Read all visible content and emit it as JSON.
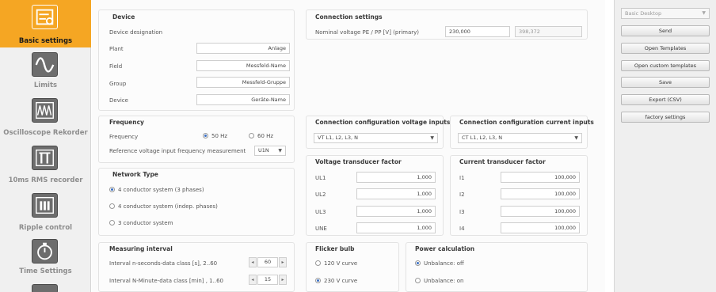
{
  "sidebar": {
    "items": [
      {
        "label": "Basic settings",
        "icon": "settings-sliders-icon",
        "active": true
      },
      {
        "label": "Limits",
        "icon": "sine-wave-icon",
        "active": false
      },
      {
        "label": "Oscilloscope Rekorder",
        "icon": "oscilloscope-icon",
        "active": false
      },
      {
        "label": "10ms RMS recorder",
        "icon": "rms-recorder-icon",
        "active": false
      },
      {
        "label": "Ripple control",
        "icon": "ripple-control-icon",
        "active": false
      },
      {
        "label": "Time Settings",
        "icon": "stopwatch-icon",
        "active": false
      }
    ]
  },
  "device": {
    "title": "Device",
    "designation_label": "Device designation",
    "plant_label": "Plant",
    "plant_value": "Anlage",
    "field_label": "Field",
    "field_value": "Messfeld-Name",
    "group_label": "Group",
    "group_value": "Messfeld-Gruppe",
    "device_label": "Device",
    "device_value": "Geräte-Name"
  },
  "connection": {
    "title": "Connection settings",
    "nominal_label": "Nominal voltage PE / PP [V] (primary)",
    "nominal_value": "230,000",
    "nominal_secondary": "398,372"
  },
  "frequency": {
    "title": "Frequency",
    "label": "Frequency",
    "opt_50": "50 Hz",
    "opt_60": "60 Hz",
    "ref_label": "Reference voltage input frequency measurement",
    "ref_value": "U1N"
  },
  "network": {
    "title": "Network Type",
    "opt1": "4 conductor system (3 phases)",
    "opt2": "4 conductor system (indep. phases)",
    "opt3": "3 conductor system"
  },
  "measuring": {
    "title": "Measuring interval",
    "n_sec_label": "Interval n-seconds-data class [s], 2..60",
    "n_sec_value": "60",
    "n_min_label": "Interval  N-Minute-data class [min] , 1..60",
    "n_min_value": "15"
  },
  "conn_voltage": {
    "title": "Connection configuration voltage inputs",
    "value": "VT L1, L2, L3, N"
  },
  "conn_current": {
    "title": "Connection configuration current inputs",
    "value": "CT L1, L2, L3, N"
  },
  "vt_factor": {
    "title": "Voltage transducer factor",
    "rows": [
      {
        "label": "UL1",
        "value": "1,000"
      },
      {
        "label": "UL2",
        "value": "1,000"
      },
      {
        "label": "UL3",
        "value": "1,000"
      },
      {
        "label": "UNE",
        "value": "1,000"
      }
    ]
  },
  "ct_factor": {
    "title": "Current transducer factor",
    "rows": [
      {
        "label": "I1",
        "value": "100,000"
      },
      {
        "label": "I2",
        "value": "100,000"
      },
      {
        "label": "I3",
        "value": "100,000"
      },
      {
        "label": "I4",
        "value": "100,000"
      }
    ]
  },
  "flicker": {
    "title": "Flicker bulb",
    "opt1": "120 V curve",
    "opt2": "230 V curve"
  },
  "power": {
    "title": "Power calculation",
    "opt1": "Unbalance: off",
    "opt2": "Unbalance: on"
  },
  "right": {
    "profile": "Basic Desktop",
    "send": "Send",
    "open_templates": "Open Templates",
    "open_custom": "Open custom templates",
    "save": "Save",
    "export": "Export (CSV)",
    "factory": "factory settings"
  },
  "colors": {
    "accent": "#f5a623",
    "radio_selected": "#3a6fc4"
  }
}
